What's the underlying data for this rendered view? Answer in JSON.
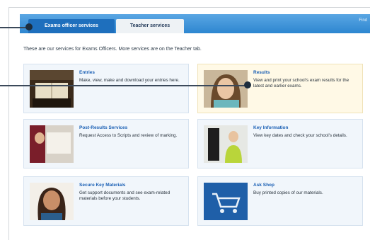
{
  "tabs": [
    {
      "label": "Exams officer services",
      "active": true
    },
    {
      "label": "Teacher services",
      "active": false
    }
  ],
  "topbar": {
    "right_text": "Find"
  },
  "intro": "These are our services for Exams Officers. More services are on the Teacher tab.",
  "cards": [
    {
      "title": "Entries",
      "description": "Make, view, make and download your entries here.",
      "icon": "ledger-book-photo"
    },
    {
      "title": "Results",
      "description": "View and print your school's exam results for the latest and earlier exams.",
      "icon": "student-photo"
    },
    {
      "title": "Post-Results Services",
      "description": "Request Access to Scripts and review of marking.",
      "icon": "post-results-photo"
    },
    {
      "title": "Key Information",
      "description": "View key dates and check your school's details.",
      "icon": "key-information-photo"
    },
    {
      "title": "Secure Key Materials",
      "description": "Get support documents and see exam-related materials before your students.",
      "icon": "teacher-photo"
    },
    {
      "title": "Ask Shop",
      "description": "Buy printed copies of our materials.",
      "icon": "shopping-cart-photo"
    }
  ],
  "colors": {
    "topbar": "#2d86d0",
    "active_tab": "#1e6fbd",
    "link": "#1a5fb4",
    "card_bg": "#f1f6fb",
    "highlight_card_bg": "#fff9e6",
    "callout": "#1c2d3d"
  }
}
